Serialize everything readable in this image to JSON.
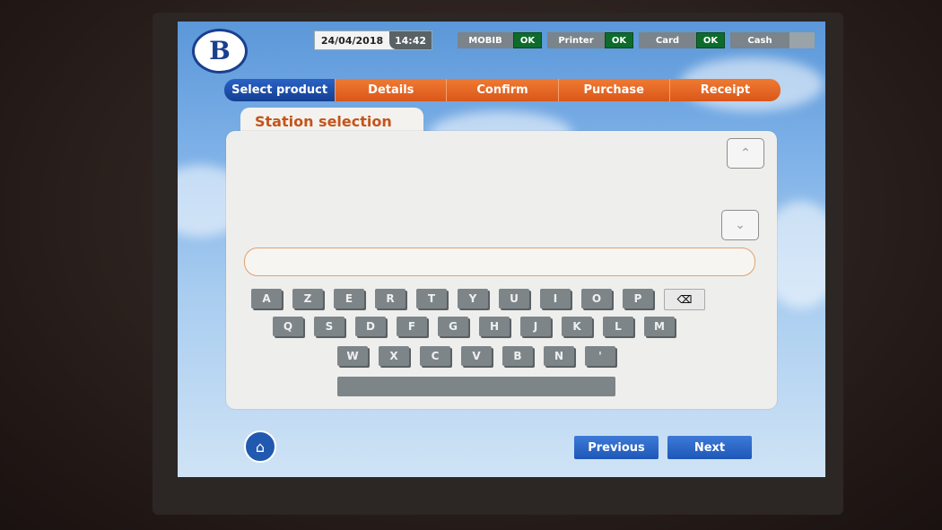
{
  "header": {
    "logo_letter": "B",
    "date": "24/04/2018",
    "time": "14:42",
    "status": [
      {
        "label": "MOBIB",
        "state": "OK"
      },
      {
        "label": "Printer",
        "state": "OK"
      },
      {
        "label": "Card",
        "state": "OK"
      },
      {
        "label": "Cash",
        "state": ""
      }
    ]
  },
  "steps": [
    "Select product",
    "Details",
    "Confirm",
    "Purchase",
    "Receipt"
  ],
  "panel": {
    "title": "Station selection",
    "search_value": ""
  },
  "keyboard": {
    "row1": [
      "A",
      "Z",
      "E",
      "R",
      "T",
      "Y",
      "U",
      "I",
      "O",
      "P"
    ],
    "row2": [
      "Q",
      "S",
      "D",
      "F",
      "G",
      "H",
      "J",
      "K",
      "L",
      "M"
    ],
    "row3": [
      "W",
      "X",
      "C",
      "V",
      "B",
      "N",
      "'"
    ]
  },
  "footer": {
    "previous_label": "Previous",
    "next_label": "Next"
  },
  "colors": {
    "brand_blue": "#1a3f8f",
    "step_orange": "#d9571a",
    "ok_green": "#0e6b2c"
  }
}
